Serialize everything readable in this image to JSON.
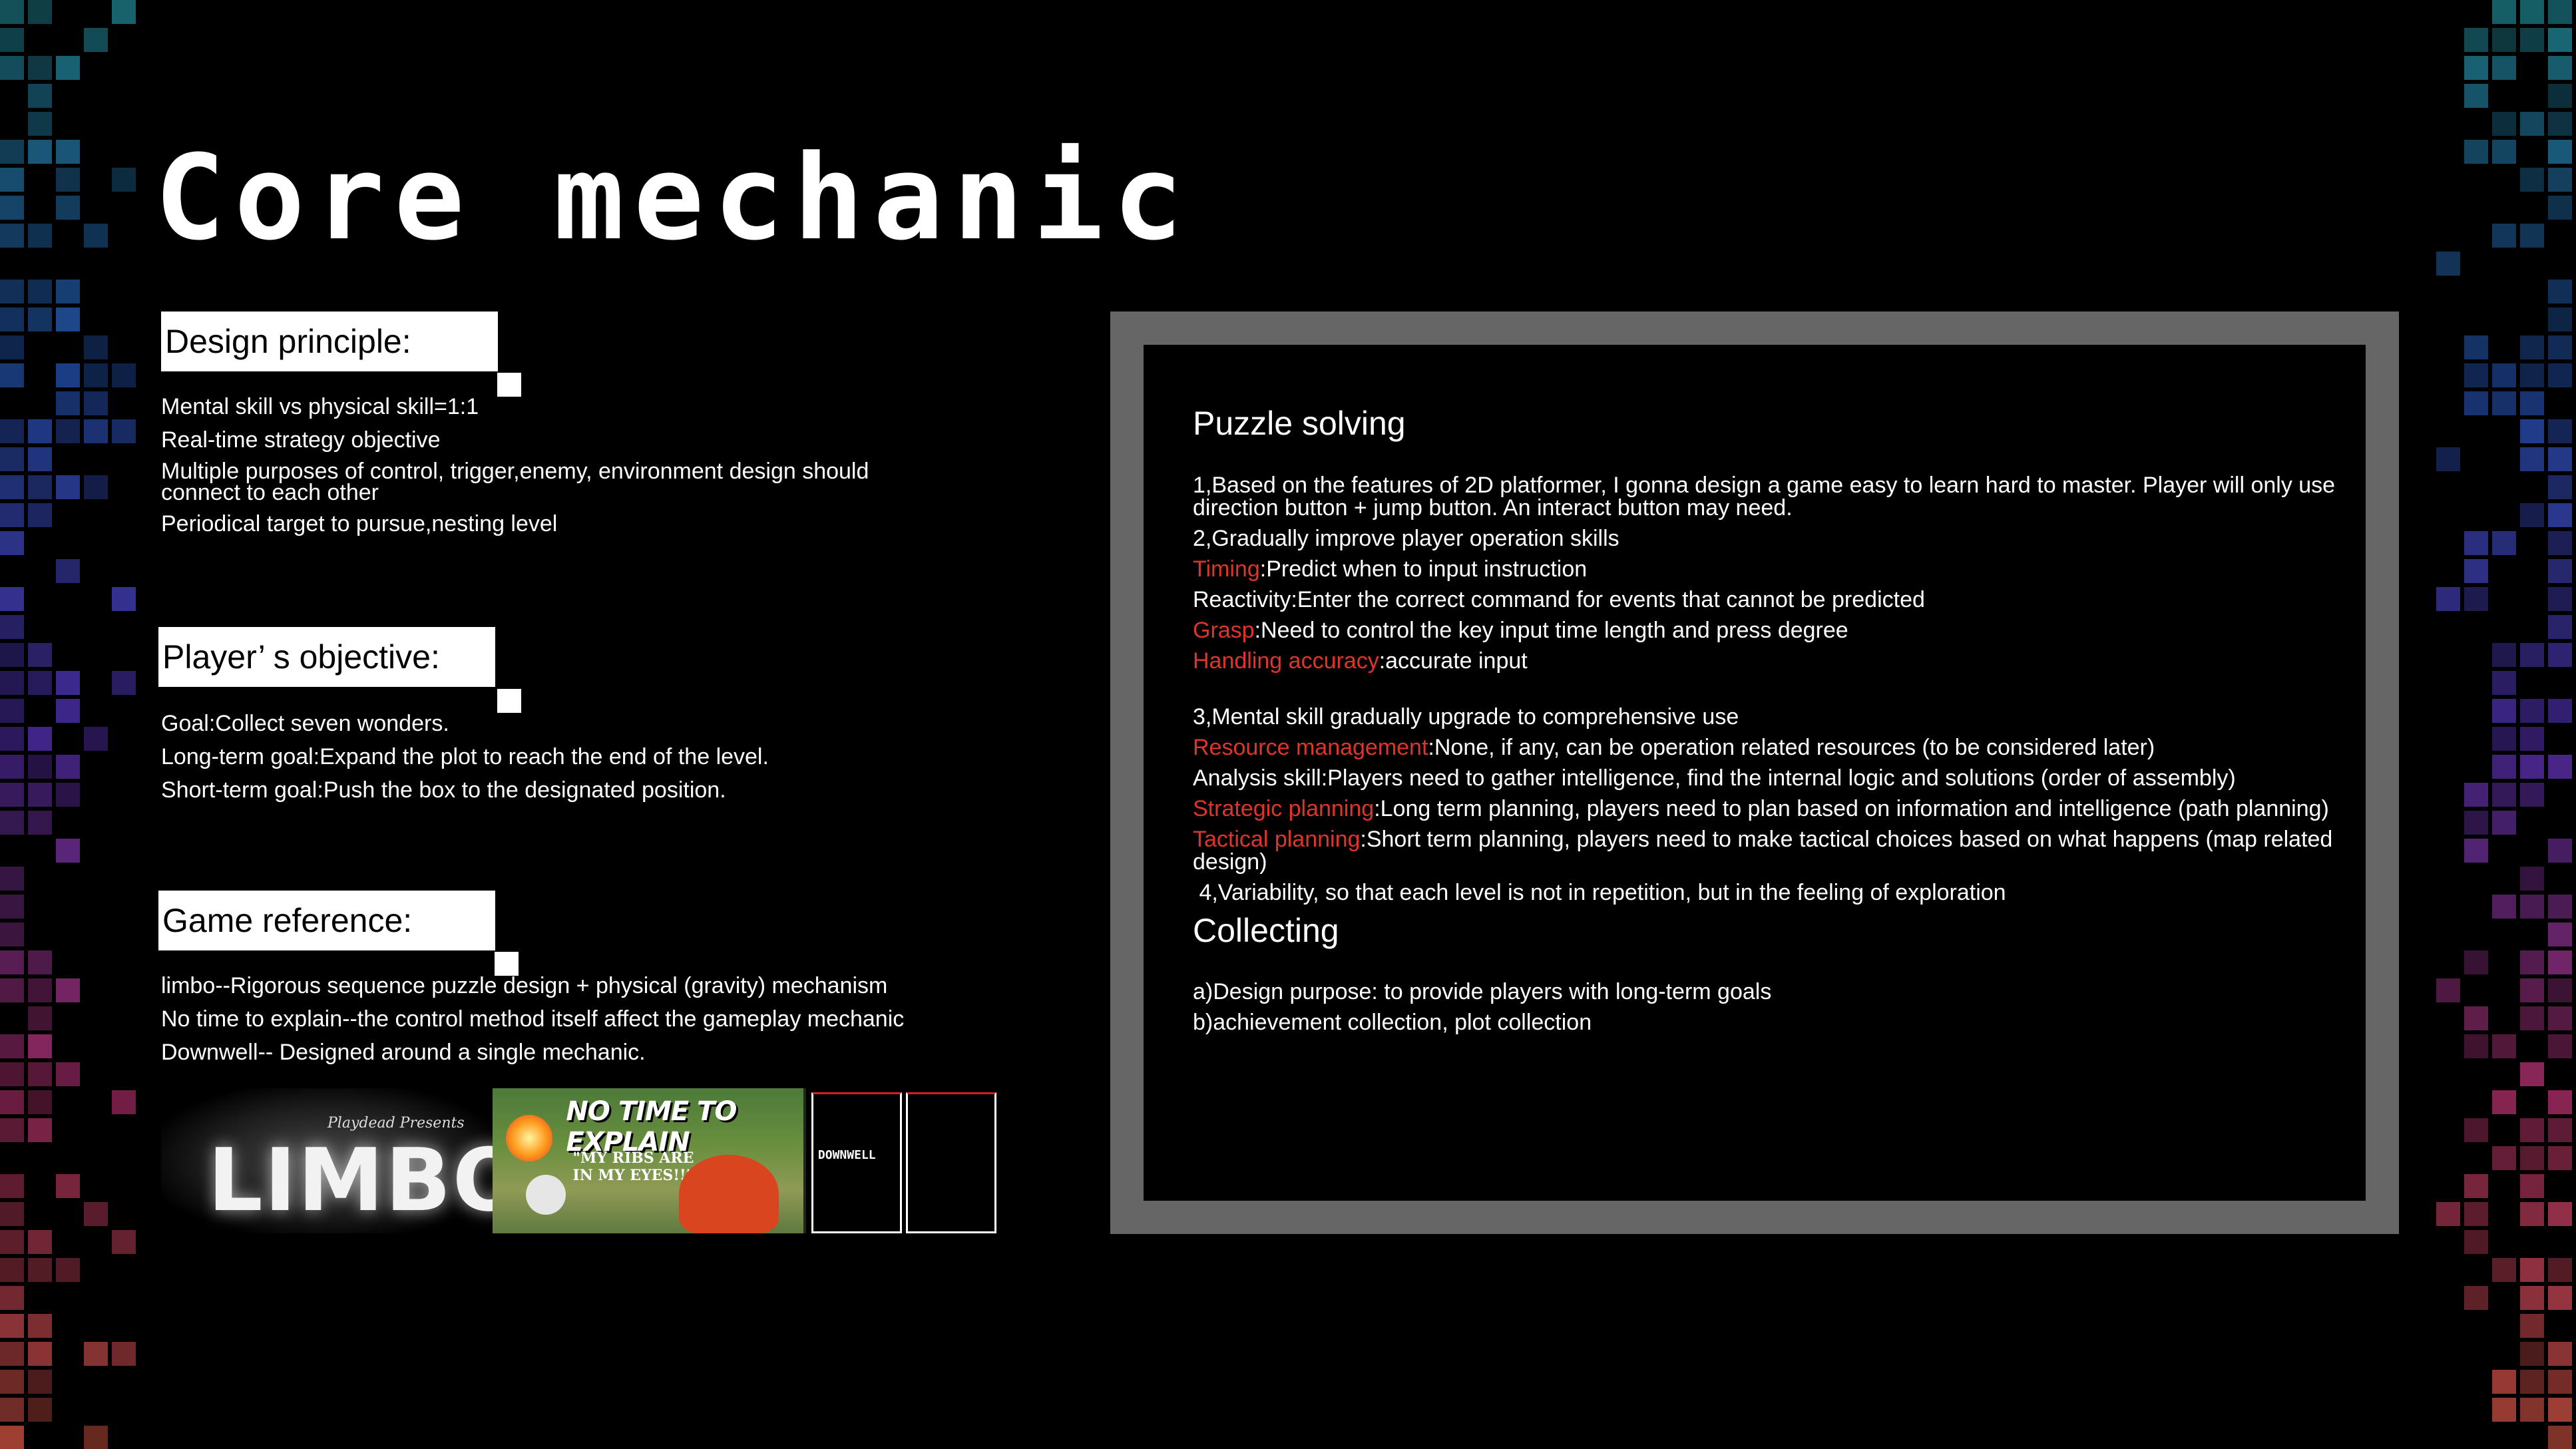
{
  "slide": {
    "title": "Core mechanic"
  },
  "design_principle": {
    "heading": "Design principle:",
    "items": [
      "Mental skill vs physical skill=1:1",
      "Real-time strategy objective",
      "Multiple purposes of control, trigger,enemy, environment design should connect to each other",
      "Periodical target to pursue,nesting level"
    ]
  },
  "player_objective": {
    "heading": "Player’ s objective:",
    "items": [
      "Goal:Collect seven wonders.",
      "Long-term goal:Expand the plot to reach the end of the level.",
      "Short-term goal:Push the box to the designated position."
    ]
  },
  "game_reference": {
    "heading": "Game reference:",
    "items": [
      "limbo--Rigorous sequence puzzle design + physical (gravity) mechanism",
      "No time to explain--the control method itself affect the gameplay mechanic",
      "Downwell-- Designed around a single mechanic."
    ],
    "images": {
      "limbo": {
        "small": "Playdead Presents",
        "logo": "LIMBO"
      },
      "ntte": {
        "logo": "NO TIME TO EXPLAIN",
        "quote": "\"MY RIBS ARE IN MY EYES!!\""
      },
      "downwell": {
        "logo": "DOWNWELL"
      }
    }
  },
  "panel": {
    "puzzle_heading": "Puzzle solving",
    "p1": "1,Based on the features of 2D platformer, I gonna design a game easy to learn hard to master. Player will only use direction button + jump button. An interact button may need.",
    "p2": "2,Gradually improve player operation skills",
    "timing_label": "Timing",
    "timing_text": ":Predict when to input instruction",
    "reactivity": "Reactivity:Enter the correct command for events that cannot be predicted",
    "grasp_label": "Grasp",
    "grasp_text": ":Need to control the key input time length and press degree",
    "handling_label": "Handling accuracy",
    "handling_text": ":accurate input",
    "p3": "3,Mental skill gradually upgrade to comprehensive use",
    "resource_label": "Resource management",
    "resource_text": ":None, if any, can be operation related resources (to be considered later)",
    "analysis": "Analysis skill:Players need to gather intelligence, find the internal logic and solutions (order of assembly)",
    "strategic_label": "Strategic planning",
    "strategic_text": ":Long term planning, players need to plan based on information and intelligence (path planning)",
    "tactical_label": "Tactical planning",
    "tactical_text": ":Short term planning, players need to make tactical choices based on what happens (map related design)",
    "p4": " 4,Variability, so that each level is not in repetition, but in the feeling of exploration",
    "collecting_heading": "Collecting",
    "c1": "a)Design purpose: to provide players with long-term goals",
    "c2": "b)achievement collection, plot collection"
  },
  "colors": {
    "background": "#000000",
    "panel_frame": "#666666",
    "highlight": "#e0342a",
    "text": "#ffffff"
  }
}
